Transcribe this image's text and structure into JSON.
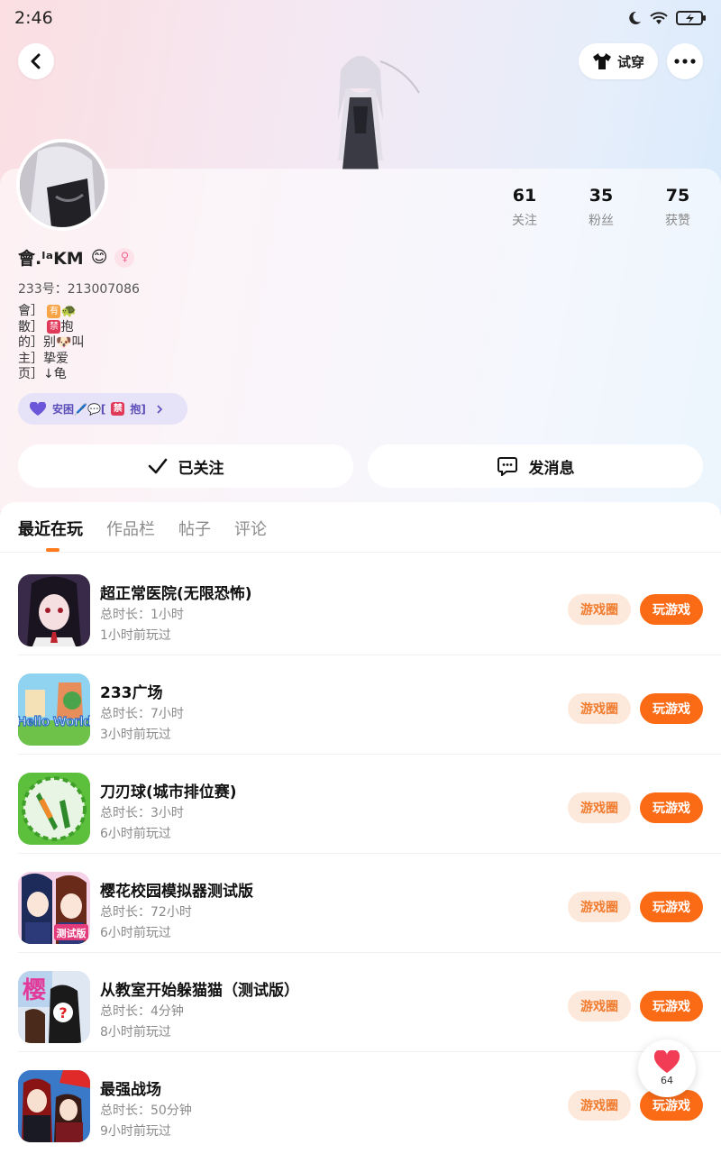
{
  "status_bar": {
    "time": "2:46"
  },
  "header": {
    "try_on_label": "试穿"
  },
  "profile": {
    "stats": [
      {
        "value": "61",
        "label": "关注"
      },
      {
        "value": "35",
        "label": "粉丝"
      },
      {
        "value": "75",
        "label": "获赞"
      }
    ],
    "nickname": "會.ˡᵃKM",
    "uid": "233号：213007086",
    "bio_lines": [
      {
        "prefix": "會］",
        "tag": "有",
        "suffix": "🐢"
      },
      {
        "prefix": "散］",
        "tag": "禁",
        "suffix": "抱"
      },
      {
        "prefix": "的］别",
        "tag": "",
        "suffix": "🐶叫"
      },
      {
        "prefix": "主］挚爱",
        "tag": "",
        "suffix": ""
      },
      {
        "prefix": "页］↓龟",
        "tag": "",
        "suffix": ""
      }
    ],
    "chip_text": "安困🖊️💬[",
    "chip_tag": "禁",
    "chip_suffix": "抱]",
    "follow_label": "已关注",
    "message_label": "发消息"
  },
  "tabs": [
    {
      "label": "最近在玩",
      "active": true
    },
    {
      "label": "作品栏",
      "active": false
    },
    {
      "label": "帖子",
      "active": false
    },
    {
      "label": "评论",
      "active": false
    }
  ],
  "games": [
    {
      "title": "超正常医院(无限恐怖)",
      "duration": "总时长：1小时",
      "last_played": "1小时前玩过",
      "icon": "anime-girl-icon"
    },
    {
      "title": "233广场",
      "duration": "总时长：7小时",
      "last_played": "3小时前玩过",
      "icon": "hello-world-icon",
      "icon_text": "Hello World"
    },
    {
      "title": "刀刃球(城市排位赛)",
      "duration": "总时长：3小时",
      "last_played": "6小时前玩过",
      "icon": "blade-ball-icon"
    },
    {
      "title": "樱花校园模拟器测试版",
      "duration": "总时长：72小时",
      "last_played": "6小时前玩过",
      "icon": "sakura-school-icon",
      "icon_text": "测试版"
    },
    {
      "title": "从教室开始躲猫猫（测试版）",
      "duration": "总时长：4分钟",
      "last_played": "8小时前玩过",
      "icon": "hide-seek-icon",
      "icon_text": "樱"
    },
    {
      "title": "最强战场",
      "duration": "总时长：50分钟",
      "last_played": "9小时前玩过",
      "icon": "battlefield-icon"
    }
  ],
  "game_buttons": {
    "circle": "游戏圈",
    "play": "玩游戏"
  },
  "like_float": {
    "count": "64"
  },
  "colors": {
    "accent": "#fb6b16",
    "accent_light": "#fde9dc",
    "chip": "#e6e2f8",
    "gender": "#f06b95"
  }
}
